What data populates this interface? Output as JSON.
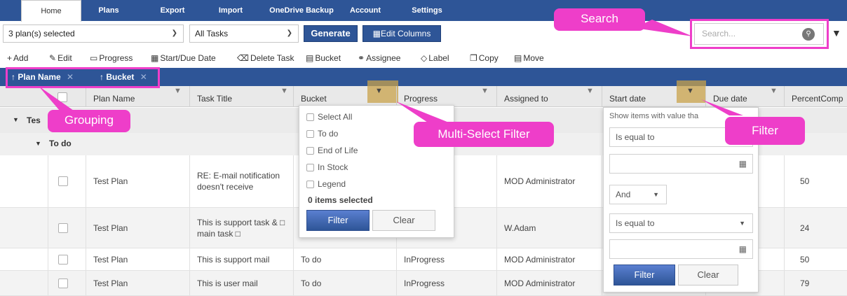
{
  "ribbon": {
    "tabs": [
      "Home",
      "Plans",
      "Export",
      "Import",
      "OneDrive Backup",
      "Account",
      "Settings"
    ],
    "active": "Home",
    "accent": "#2e5597"
  },
  "toolbar": {
    "plan_select": "3 plan(s) selected",
    "task_select": "All Tasks",
    "generate": "Generate",
    "edit_columns": "Edit Columns",
    "search_placeholder": "Search..."
  },
  "actions": [
    "Add",
    "Edit",
    "Progress",
    "Start/Due Date",
    "Delete Task",
    "Bucket",
    "Assignee",
    "Label",
    "Copy",
    "Move"
  ],
  "grouping": {
    "chips": [
      "Plan Name",
      "Bucket"
    ],
    "arrow": "↑",
    "close": "✕"
  },
  "columns": [
    "Plan Name",
    "Task Title",
    "Bucket",
    "Progress",
    "Assigned to",
    "Start date",
    "Due date",
    "PercentComp"
  ],
  "groups": {
    "level1": "Tes",
    "level2": "To do"
  },
  "rows": [
    {
      "plan": "Test Plan",
      "title": "RE: E-mail notification doesn't receive",
      "bucket": "",
      "progress": "",
      "assigned": "MOD Administrator",
      "percent": "50"
    },
    {
      "plan": "Test Plan",
      "title": "This is support task & □ main task □",
      "bucket": "",
      "progress": "",
      "assigned": "W.Adam",
      "percent": "24"
    },
    {
      "plan": "Test Plan",
      "title": "This is support mail",
      "bucket": "To do",
      "progress": "InProgress",
      "assigned": "MOD Administrator",
      "percent": "50"
    },
    {
      "plan": "Test Plan",
      "title": "This is user mail",
      "bucket": "To do",
      "progress": "InProgress",
      "assigned": "MOD Administrator",
      "percent": "79"
    }
  ],
  "multi_filter": {
    "items": [
      "Select All",
      "To do",
      "End of Life",
      "In Stock",
      "Legend"
    ],
    "count": "0 items selected",
    "filter": "Filter",
    "clear": "Clear"
  },
  "date_filter": {
    "caption": "Show items with value tha",
    "op1": "Is equal to",
    "logic": "And",
    "op2": "Is equal to",
    "filter": "Filter",
    "clear": "Clear"
  },
  "callouts": {
    "search": "Search",
    "grouping": "Grouping",
    "multi": "Multi-Select Filter",
    "filter": "Filter"
  },
  "callout_color": "#ee3ec9"
}
